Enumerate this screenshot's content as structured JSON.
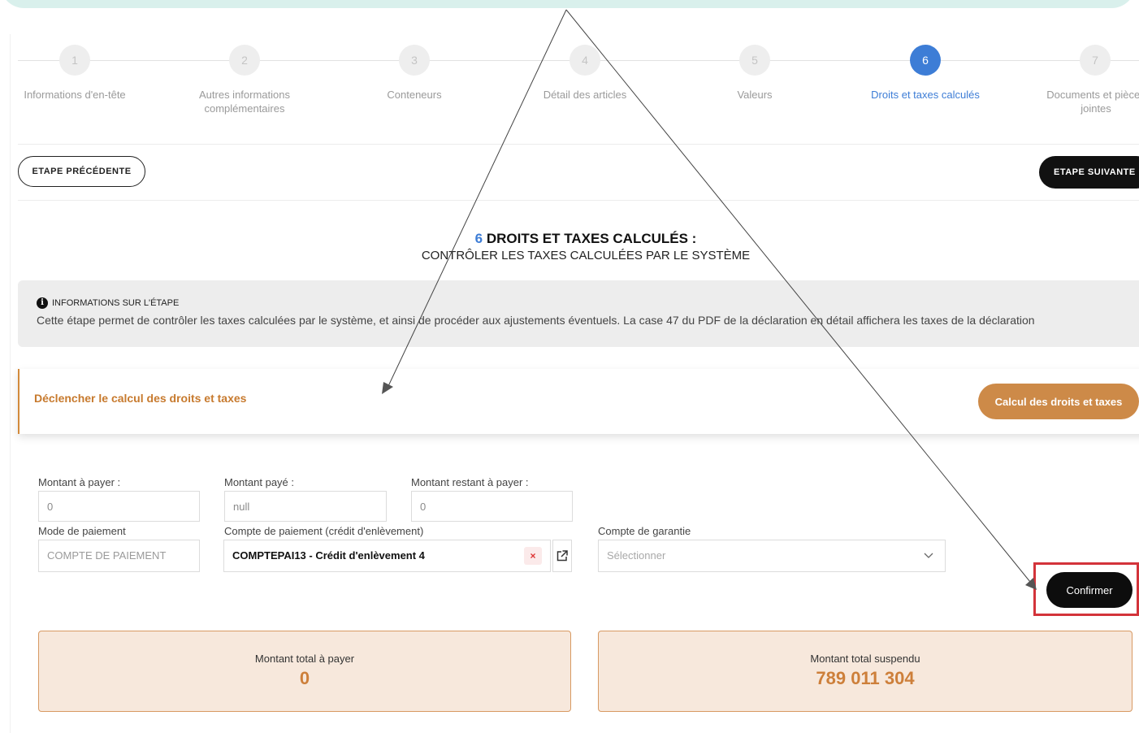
{
  "stepper": {
    "steps": [
      {
        "number": "1",
        "label": "Informations d'en-tête"
      },
      {
        "number": "2",
        "label": "Autres informations complémentaires"
      },
      {
        "number": "3",
        "label": "Conteneurs"
      },
      {
        "number": "4",
        "label": "Détail des articles"
      },
      {
        "number": "5",
        "label": "Valeurs"
      },
      {
        "number": "6",
        "label": "Droits et taxes calculés"
      },
      {
        "number": "7",
        "label": "Documents et pièces jointes"
      }
    ],
    "active_step": 6
  },
  "nav": {
    "prev_label": "ETAPE PRÉCÉDENTE",
    "next_label": "ETAPE SUIVANTE"
  },
  "heading": {
    "step_number": "6",
    "title": "DROITS ET TAXES CALCULÉS :",
    "subtitle": "CONTRÔLER LES TAXES CALCULÉES PAR LE SYSTÈME"
  },
  "info": {
    "icon": "info-icon",
    "heading": "INFORMATIONS SUR L'ÉTAPE",
    "text": "Cette étape permet de contrôler les taxes calculées par le système, et ainsi de procéder aux ajustements éventuels. La case 47 du PDF de la déclaration en détail affichera les taxes de la déclaration"
  },
  "trigger": {
    "label": "Déclencher le calcul des droits et taxes",
    "button": "Calcul des droits et taxes"
  },
  "form": {
    "montant_a_payer": {
      "label": "Montant à payer :",
      "value": "0"
    },
    "montant_paye": {
      "label": "Montant payé :",
      "value": "null"
    },
    "montant_restant": {
      "label": "Montant restant à payer :",
      "value": "0"
    },
    "mode_paiement": {
      "label": "Mode de paiement",
      "value": "COMPTE DE PAIEMENT"
    },
    "compte_paiement": {
      "label": "Compte de paiement (crédit d'enlèvement)",
      "value": "COMPTEPAI13 - Crédit d'enlèvement 4",
      "clear": "×"
    },
    "compte_garantie": {
      "label": "Compte de garantie",
      "placeholder": "Sélectionner"
    }
  },
  "confirm_label": "Confirmer",
  "totals": {
    "a_payer": {
      "label": "Montant total à payer",
      "value": "0"
    },
    "suspendu": {
      "label": "Montant total suspendu",
      "value": "789 011 304"
    }
  },
  "colors": {
    "accent_blue": "#3d7dd6",
    "accent_orange": "#cd8a48",
    "highlight_red": "#d3333a"
  }
}
